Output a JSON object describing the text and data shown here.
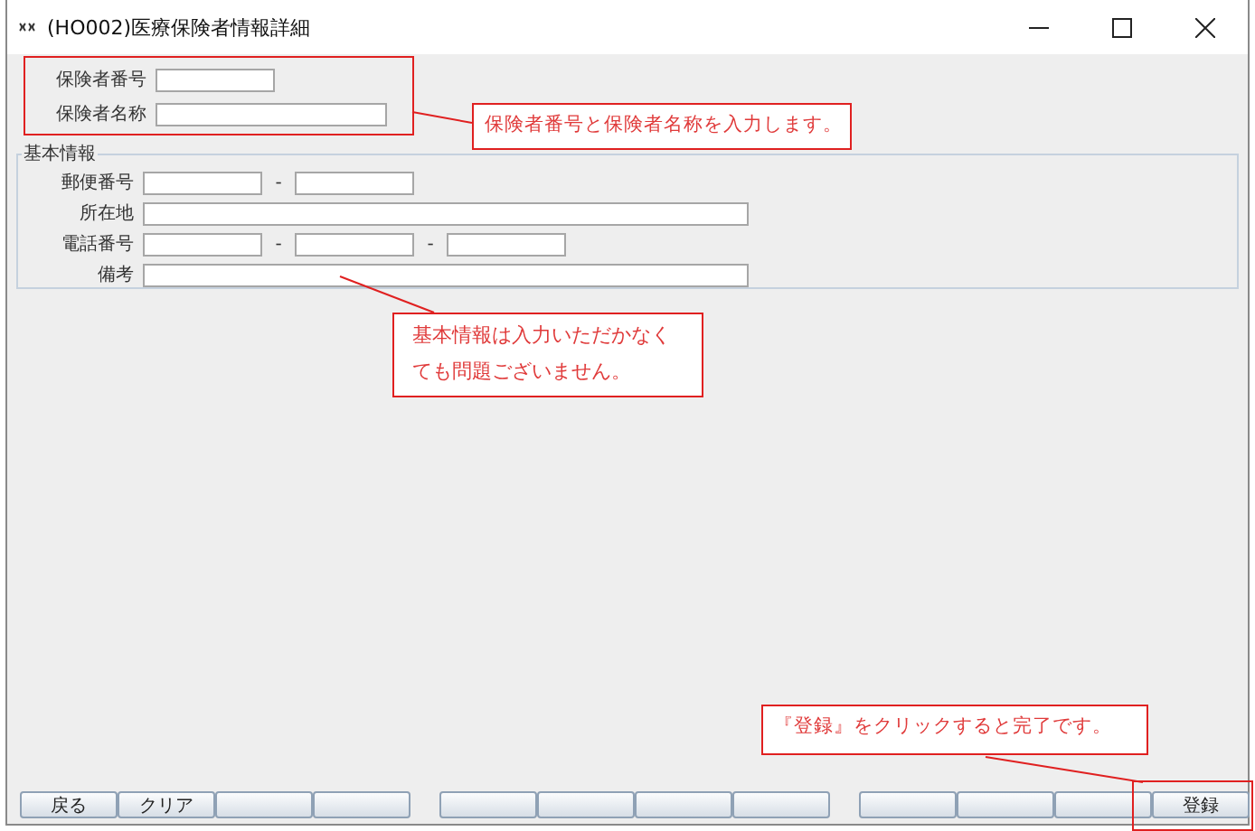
{
  "window": {
    "title": "(HO002)医療保険者情報詳細"
  },
  "insurer": [
    {
      "label": "保険者番号",
      "parts": [
        {
          "kind": "short"
        }
      ]
    },
    {
      "label": "保険者名称",
      "parts": [
        {
          "kind": "medium"
        }
      ]
    }
  ],
  "basic_info": {
    "title": "基本情報",
    "rows": [
      {
        "label": "郵便番号",
        "parts": [
          {
            "kind": "short"
          },
          {
            "kind": "dash",
            "text": "-"
          },
          {
            "kind": "short"
          }
        ]
      },
      {
        "label": "所在地",
        "parts": [
          {
            "kind": "long"
          }
        ]
      },
      {
        "label": "電話番号",
        "parts": [
          {
            "kind": "short"
          },
          {
            "kind": "dash",
            "text": "-"
          },
          {
            "kind": "short"
          },
          {
            "kind": "dash",
            "text": "-"
          },
          {
            "kind": "short"
          }
        ]
      },
      {
        "label": "備考",
        "parts": [
          {
            "kind": "long"
          }
        ]
      }
    ]
  },
  "button_groups": [
    [
      {
        "kind": "labeled",
        "label": "戻る"
      },
      {
        "kind": "labeled",
        "label": "クリア"
      },
      {
        "kind": "blank"
      },
      {
        "kind": "blank"
      }
    ],
    [
      {
        "kind": "blank"
      },
      {
        "kind": "blank"
      },
      {
        "kind": "blank"
      },
      {
        "kind": "blank"
      }
    ],
    [
      {
        "kind": "blank"
      },
      {
        "kind": "blank"
      },
      {
        "kind": "blank"
      },
      {
        "kind": "labeled",
        "label": "登録"
      }
    ]
  ],
  "annotations": [
    {
      "text": "保険者番号と保険者名称を入力します。"
    },
    {
      "text": "基本情報は入力いただかなくても問題ございません。"
    },
    {
      "text": "『登録』をクリックすると完了です。"
    }
  ]
}
